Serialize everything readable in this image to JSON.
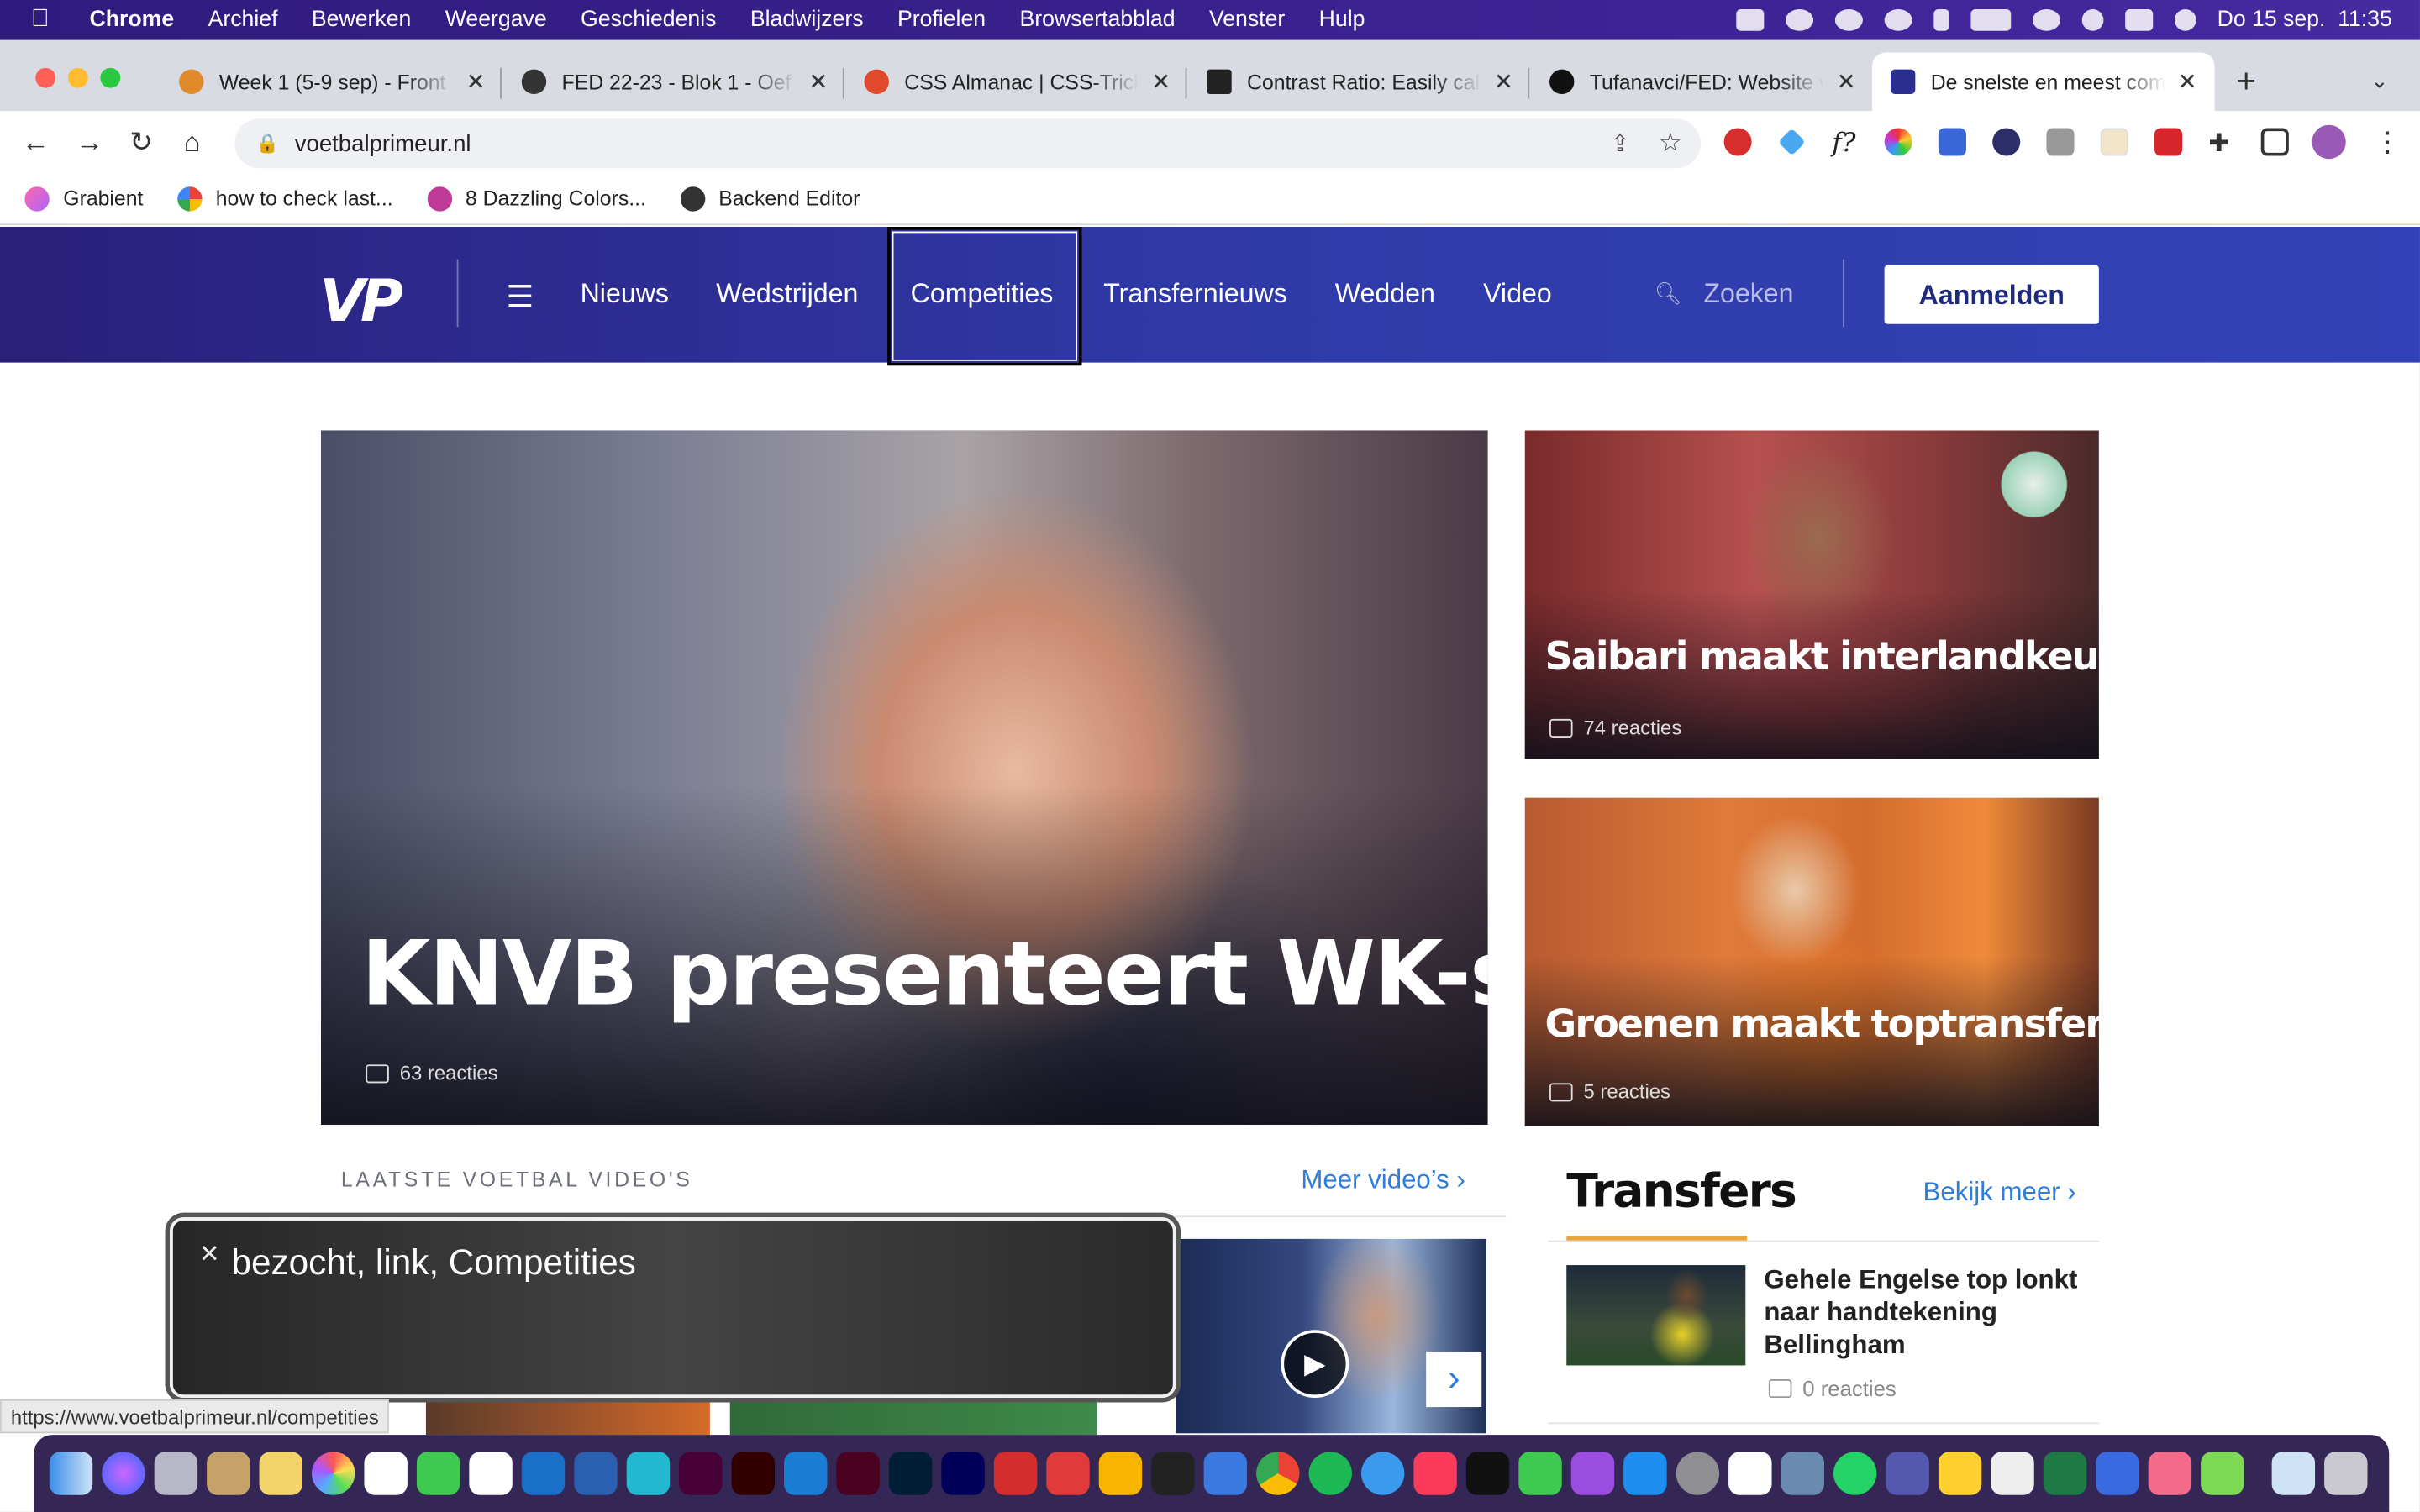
{
  "menubar": {
    "app": "Chrome",
    "items": [
      "Archief",
      "Bewerken",
      "Weergave",
      "Geschiedenis",
      "Bladwijzers",
      "Profielen",
      "Browsertabblad",
      "Venster",
      "Hulp"
    ],
    "datetime": "Do 15 sep.  11:35"
  },
  "tabs": [
    {
      "title": "Week 1 (5-9 sep) - Front",
      "fav": "#e08a2b"
    },
    {
      "title": "FED 22-23 - Blok 1 - Oef",
      "fav": "#333"
    },
    {
      "title": "CSS Almanac | CSS-Tricks",
      "fav": "#e04a2a"
    },
    {
      "title": "Contrast Ratio: Easily cal",
      "fav": "#222"
    },
    {
      "title": "Tufanavci/FED: Website v",
      "fav": "#111"
    },
    {
      "title": "De snelste en meest com",
      "fav": "#2a2f8f"
    }
  ],
  "url": "voetbalprimeur.nl",
  "bookmarks": [
    {
      "label": "Grabient",
      "color": "#e28bd6"
    },
    {
      "label": "how to check last...",
      "color": "#4285f4"
    },
    {
      "label": "8 Dazzling Colors...",
      "color": "#c03a9a"
    },
    {
      "label": "Backend Editor",
      "color": "#333"
    }
  ],
  "site": {
    "logo": "VP",
    "nav": [
      "Nieuws",
      "Wedstrijden",
      "Competities",
      "Transfernieuws",
      "Wedden",
      "Video"
    ],
    "search_placeholder": "Zoeken",
    "login": "Aanmelden"
  },
  "hero": {
    "title": "KNVB presenteert WK-shirts",
    "reactions": "63 reacties"
  },
  "side_articles": [
    {
      "title": "Saibari maakt interlandkeuze",
      "reactions": "74 reacties"
    },
    {
      "title": "Groenen maakt toptransfer",
      "reactions": "5 reacties"
    }
  ],
  "videos": {
    "heading": "LAATSTE VOETBAL VIDEO'S",
    "more": "Meer video’s ›"
  },
  "transfers": {
    "heading": "Transfers",
    "more": "Bekijk meer ›",
    "item_title": "Gehele Engelse top lonkt naar handtekening Bellingham",
    "item_reactions": "0 reacties"
  },
  "voiceover": "bezocht, link, Competities",
  "status_url": "https://www.voetbalprimeur.nl/competities",
  "colors": {
    "nav_bg": "#2f3aa8",
    "accent": "#2e7ddb",
    "transfer_underline": "#e6a73f"
  }
}
